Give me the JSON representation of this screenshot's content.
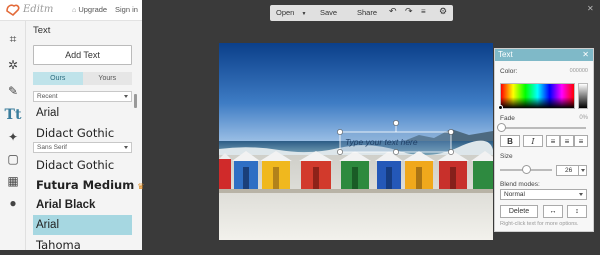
{
  "brand": {
    "name": "Editm",
    "upgrade_label": "Upgrade",
    "signin_label": "Sign in"
  },
  "tools": [
    {
      "name": "crop",
      "glyph": "⌗"
    },
    {
      "name": "effects",
      "glyph": "✲"
    },
    {
      "name": "touch-up",
      "glyph": "✎"
    },
    {
      "name": "text",
      "glyph": "Tt",
      "active": true
    },
    {
      "name": "overlays",
      "glyph": "✦"
    },
    {
      "name": "frames",
      "glyph": "▢"
    },
    {
      "name": "textures",
      "glyph": "▦"
    },
    {
      "name": "seasonal",
      "glyph": "●"
    }
  ],
  "panel": {
    "title": "Text",
    "add_text_label": "Add Text",
    "tabs": [
      {
        "label": "Ours",
        "active": true
      },
      {
        "label": "Yours",
        "active": false
      }
    ],
    "group1_select": "Recent",
    "group1_fonts": [
      {
        "label": "Arial",
        "family": "\"Liberation Sans\", sans-serif",
        "weight": "normal",
        "style": "normal"
      },
      {
        "label": "Didact Gothic",
        "family": "\"DejaVu Sans\", sans-serif",
        "weight": "normal",
        "style": "normal"
      }
    ],
    "group2_select": "Sans Serif",
    "group2_fonts": [
      {
        "label": "Didact Gothic",
        "family": "\"DejaVu Sans\", sans-serif",
        "weight": "normal",
        "style": "normal"
      },
      {
        "label": "Futura Medium",
        "family": "\"DejaVu Sans\", sans-serif",
        "weight": "bold",
        "style": "normal",
        "premium": true
      },
      {
        "label": "Arial Black",
        "family": "\"Liberation Sans\", sans-serif",
        "weight": "bold",
        "style": "normal"
      },
      {
        "label": "Arial",
        "family": "\"Liberation Sans\", sans-serif",
        "weight": "normal",
        "style": "normal",
        "selected": true
      },
      {
        "label": "Tahoma",
        "family": "\"DejaVu Sans\", sans-serif",
        "weight": "normal",
        "style": "normal"
      }
    ]
  },
  "toolbar": {
    "open_label": "Open",
    "save_label": "Save",
    "share_label": "Share"
  },
  "canvas": {
    "placeholder_text": "Type your text here"
  },
  "props": {
    "title": "Text",
    "color_label": "Color:",
    "color_value": "000000",
    "fade_label": "Fade",
    "fade_value": "0%",
    "fade_level": 0,
    "bold_label": "B",
    "italic_label": "I",
    "size_label": "Size",
    "size_value": "26",
    "blend_label": "Blend modes:",
    "blend_value": "Normal",
    "delete_label": "Delete",
    "hint": "Right-click text for more options."
  },
  "colors": {
    "accent": "#7fb9c8",
    "selected_font_bg": "#a6d7e1",
    "tab_active_bg": "#bfe3ea"
  }
}
